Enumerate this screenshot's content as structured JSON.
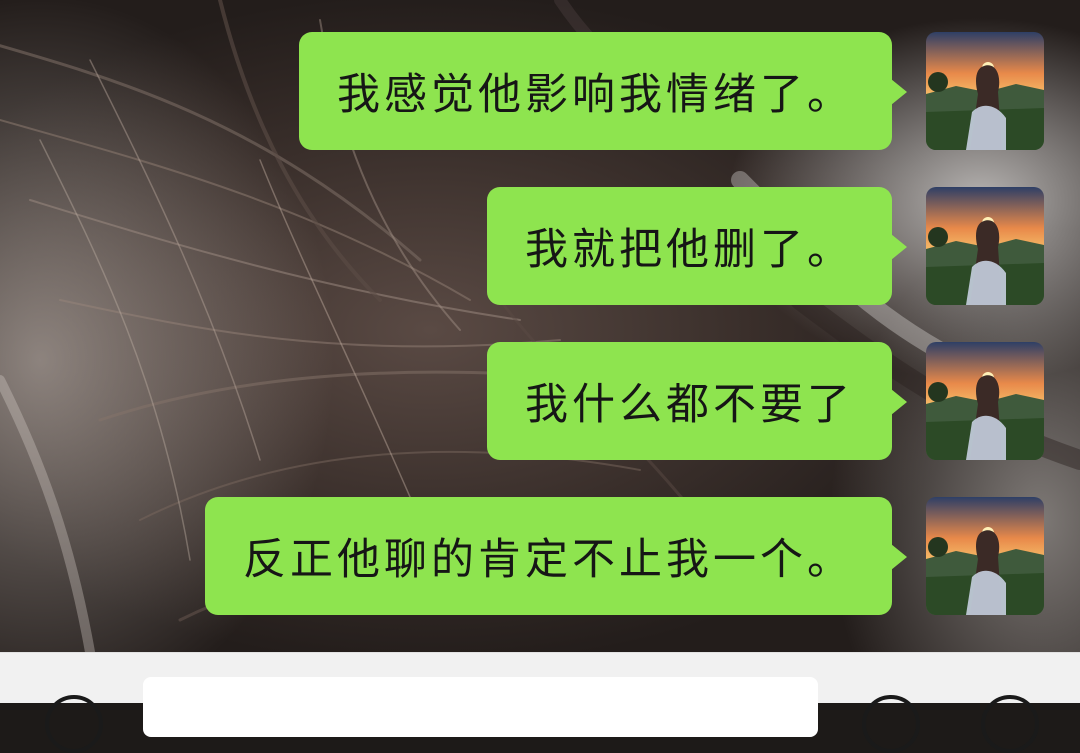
{
  "chat": {
    "messages": [
      {
        "text": "我感觉他影响我情绪了。",
        "from": "self",
        "avatar": "sunset-girl-avatar"
      },
      {
        "text": "我就把他删了。",
        "from": "self",
        "avatar": "sunset-girl-avatar"
      },
      {
        "text": "我什么都不要了",
        "from": "self",
        "avatar": "sunset-girl-avatar"
      },
      {
        "text": "反正他聊的肯定不止我一个。",
        "from": "self",
        "avatar": "sunset-girl-avatar"
      }
    ]
  },
  "input_bar": {
    "left_icon": "voice-icon",
    "message_value": "",
    "right_icons": [
      "emoji-icon",
      "plus-icon"
    ]
  },
  "colors": {
    "bubble_self": "#8ee44f",
    "input_bar_bg": "#f1f1f1",
    "text": "#161616"
  }
}
